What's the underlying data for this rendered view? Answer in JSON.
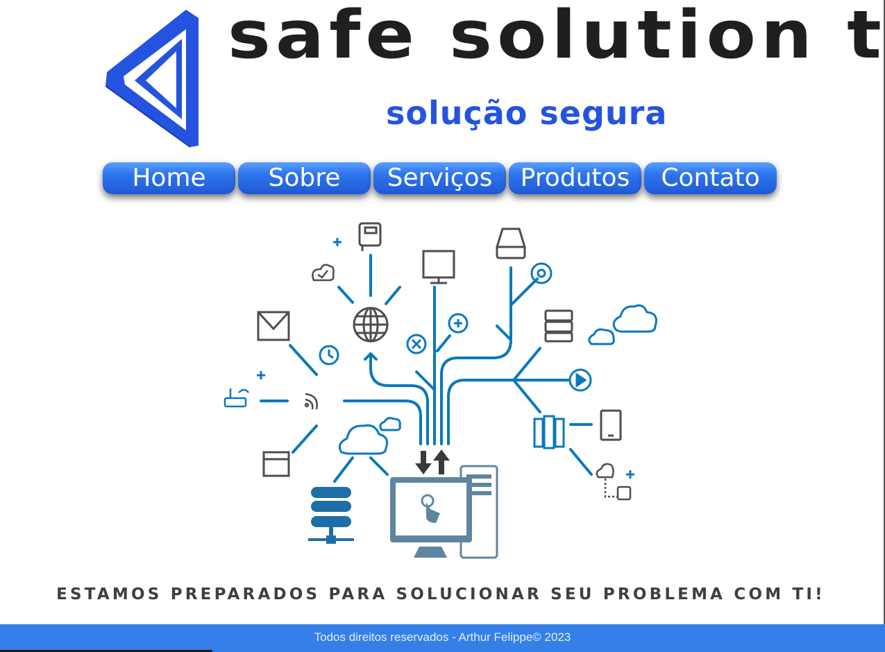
{
  "header": {
    "brand_name": "safe solution ti",
    "tagline": "solução segura"
  },
  "nav": {
    "items": [
      {
        "label": "Home"
      },
      {
        "label": "Sobre"
      },
      {
        "label": "Serviços"
      },
      {
        "label": "Produtos"
      },
      {
        "label": "Contato"
      }
    ]
  },
  "main": {
    "illustration": "network-technology-illustration",
    "headline": "ESTAMOS PREPARADOS PARA SOLUCIONAR SEU PROBLEMA COM TI!"
  },
  "footer": {
    "text": "Todos direitos reservados - Arthur Felippe© 2023"
  },
  "colors": {
    "brand_blue": "#2453e0",
    "nav_blue": "#2f77ee",
    "footer_blue": "#3580e8",
    "illustration_blue": "#0a78bd",
    "illustration_gray": "#4d4d4d",
    "text_dark": "#1f1f1f"
  }
}
